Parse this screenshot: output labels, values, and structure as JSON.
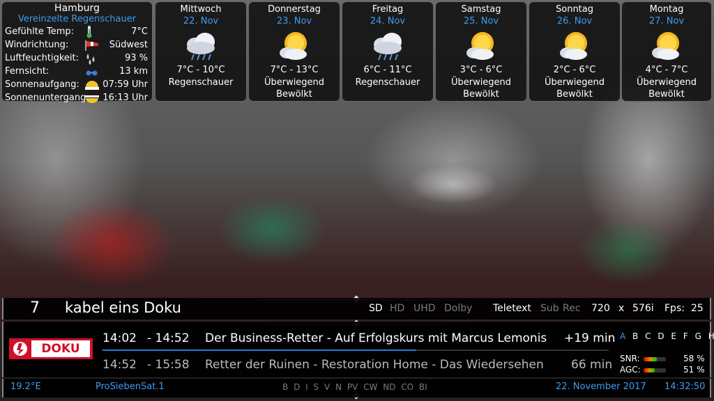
{
  "current": {
    "city": "Hamburg",
    "condition": "Vereinzelte Regenschauer",
    "rows": [
      {
        "label": "Gefühlte Temp:",
        "value": "7°C",
        "icon": "thermometer-icon"
      },
      {
        "label": "Windrichtung:",
        "value": "Südwest",
        "icon": "windsock-icon"
      },
      {
        "label": "Luftfeuchtigkeit:",
        "value": "93 %",
        "icon": "humidity-icon"
      },
      {
        "label": "Fernsicht:",
        "value": "13 km",
        "icon": "visibility-icon"
      },
      {
        "label": "Sonnenaufgang:",
        "value": "07:59 Uhr",
        "icon": "sunrise-icon"
      },
      {
        "label": "Sonnenuntergang:",
        "value": "16:13 Uhr",
        "icon": "sunset-icon"
      }
    ]
  },
  "forecast": [
    {
      "day": "Mittwoch",
      "date": "22. Nov",
      "temp": "7°C - 10°C",
      "cond1": "Regenschauer",
      "cond2": "",
      "icon": "rain-cloud-icon"
    },
    {
      "day": "Donnerstag",
      "date": "23. Nov",
      "temp": "7°C - 13°C",
      "cond1": "Überwiegend",
      "cond2": "Bewölkt",
      "icon": "sun-cloud-icon"
    },
    {
      "day": "Freitag",
      "date": "24. Nov",
      "temp": "6°C - 11°C",
      "cond1": "Regenschauer",
      "cond2": "",
      "icon": "rain-cloud-icon"
    },
    {
      "day": "Samstag",
      "date": "25. Nov",
      "temp": "3°C - 6°C",
      "cond1": "Überwiegend",
      "cond2": "Bewölkt",
      "icon": "sun-cloud-icon"
    },
    {
      "day": "Sonntag",
      "date": "26. Nov",
      "temp": "2°C - 6°C",
      "cond1": "Überwiegend",
      "cond2": "Bewölkt",
      "icon": "sun-cloud-icon"
    },
    {
      "day": "Montag",
      "date": "27. Nov",
      "temp": "4°C - 7°C",
      "cond1": "Überwiegend",
      "cond2": "Bewölkt",
      "icon": "sun-cloud-icon"
    }
  ],
  "channel": {
    "number": "7",
    "name": "kabel eins Doku",
    "logo_text": "DOKU",
    "provider": "ProSiebenSat.1",
    "satellite": "19.2°E"
  },
  "flags": {
    "sd": "SD",
    "hd": "HD",
    "uhd": "UHD",
    "dolby": "Dolby",
    "teletext": "Teletext",
    "sub": "Sub",
    "rec": "Rec",
    "width": "720",
    "x": "x",
    "height": "576i",
    "fps_label": "Fps:",
    "fps": "25"
  },
  "now": {
    "start": "14:02",
    "end": "- 14:52",
    "title": "Der Business-Retter - Auf Erfolgskurs mit Marcus Lemonis",
    "remaining": "+19 min",
    "progress": 0.62
  },
  "next": {
    "start": "14:52",
    "end": "- 15:58",
    "title": "Retter der Ruinen - Restoration Home - Das Wiedersehen",
    "duration": "66 min"
  },
  "tuners": [
    "A",
    "B",
    "C",
    "D",
    "E",
    "F",
    "G",
    "H"
  ],
  "signal": {
    "snr_label": "SNR:",
    "snr": "58 %",
    "snr_value": 0.58,
    "agc_label": "AGC:",
    "agc": "51 %",
    "agc_value": 0.51
  },
  "caids": [
    "B",
    "D",
    "I",
    "S",
    "V",
    "N",
    "PV",
    "CW",
    "ND",
    "CO",
    "BI"
  ],
  "status": {
    "date": "22. November 2017",
    "time": "14:32:50"
  },
  "colors": {
    "accent": "#3d9cf0",
    "logo_red": "#d0102a"
  }
}
